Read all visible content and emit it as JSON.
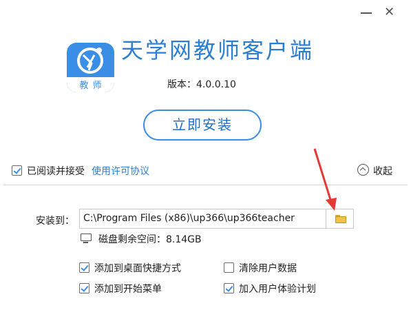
{
  "window": {
    "minimize_icon": "minimize-icon",
    "close_icon": "close-icon",
    "close_glyph": "✕"
  },
  "app": {
    "title": "天学网教师客户端",
    "version": "版本：4.0.0.10",
    "logo_text": "教师"
  },
  "install_button": "立即安装",
  "agreement": {
    "checked": true,
    "text": "已阅读并接受",
    "link": "使用许可协议"
  },
  "collapse": {
    "label": "收起"
  },
  "install_path": {
    "label": "安装到：",
    "value": "C:\\Program Files (x86)\\up366\\up366teacher"
  },
  "disk": {
    "text": "磁盘剩余空间：8.14GB"
  },
  "options": [
    {
      "label": "添加到桌面快捷方式",
      "checked": true
    },
    {
      "label": "清除用户数据",
      "checked": false
    },
    {
      "label": "添加到开始菜单",
      "checked": true
    },
    {
      "label": "加入用户体验计划",
      "checked": true
    }
  ],
  "colors": {
    "accent": "#3a8ee6",
    "title": "#2b7fd3",
    "arrow": "#e53935"
  }
}
